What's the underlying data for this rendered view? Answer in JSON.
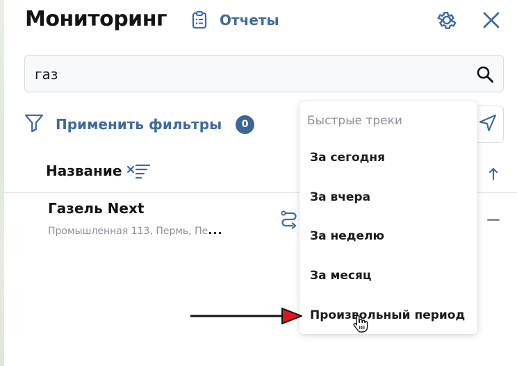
{
  "header": {
    "title": "Мониторинг",
    "reports_label": "Отчеты"
  },
  "search": {
    "value": "газ"
  },
  "filters": {
    "label": "Применить фильтры",
    "count": "0"
  },
  "table": {
    "column_name": "Название"
  },
  "item": {
    "name": "Газель Next",
    "address": "Промышленная 113, Пермь, Пе",
    "ellipsis": "..."
  },
  "dropdown": {
    "title": "Быстрые треки",
    "options": [
      "За сегодня",
      "За вчера",
      "За неделю",
      "За месяц",
      "Произвольный период"
    ]
  },
  "colors": {
    "accent": "#3f6a9e",
    "badge": "#3d6596",
    "arrow_head": "#e0161b"
  }
}
